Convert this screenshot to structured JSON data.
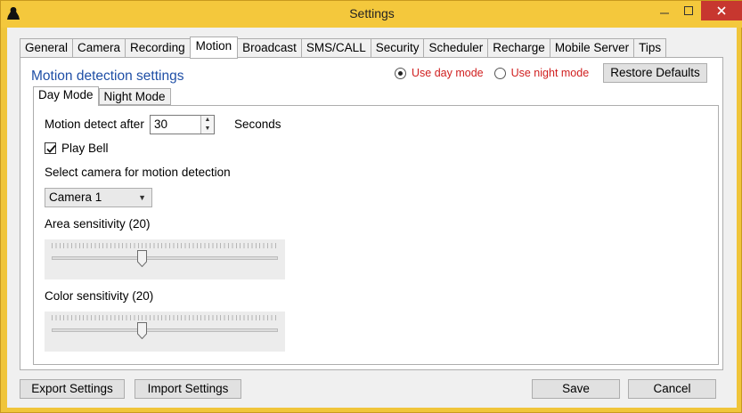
{
  "window": {
    "title": "Settings"
  },
  "tabs": [
    {
      "label": "General",
      "active": false
    },
    {
      "label": "Camera",
      "active": false
    },
    {
      "label": "Recording",
      "active": false
    },
    {
      "label": "Motion",
      "active": true
    },
    {
      "label": "Broadcast",
      "active": false
    },
    {
      "label": "SMS/CALL",
      "active": false
    },
    {
      "label": "Security",
      "active": false
    },
    {
      "label": "Scheduler",
      "active": false
    },
    {
      "label": "Recharge",
      "active": false
    },
    {
      "label": "Mobile Server",
      "active": false
    },
    {
      "label": "Tips",
      "active": false
    }
  ],
  "motion": {
    "section_title": "Motion detection settings",
    "day_mode_label": "Use day mode",
    "night_mode_label": "Use night mode",
    "day_mode_selected": true,
    "restore_label": "Restore Defaults",
    "subtabs": [
      {
        "label": "Day Mode",
        "active": true
      },
      {
        "label": "Night Mode",
        "active": false
      }
    ],
    "detect_after_label": "Motion detect after",
    "detect_after_value": "30",
    "detect_after_unit": "Seconds",
    "play_bell_label": "Play Bell",
    "play_bell_checked": true,
    "camera_select_label": "Select camera for motion detection",
    "camera_selected": "Camera 1",
    "area_label": "Area sensitivity (20)",
    "area_value": 20,
    "color_label": "Color sensitivity (20)",
    "color_value": 20,
    "slider_max": 50
  },
  "footer": {
    "export_label": "Export Settings",
    "import_label": "Import Settings",
    "save_label": "Save",
    "cancel_label": "Cancel"
  },
  "colors": {
    "accent_title": "#1f4fa6",
    "radio_text": "#d01f1f",
    "window_frame": "#f0c53a",
    "close_button": "#c7372f"
  }
}
